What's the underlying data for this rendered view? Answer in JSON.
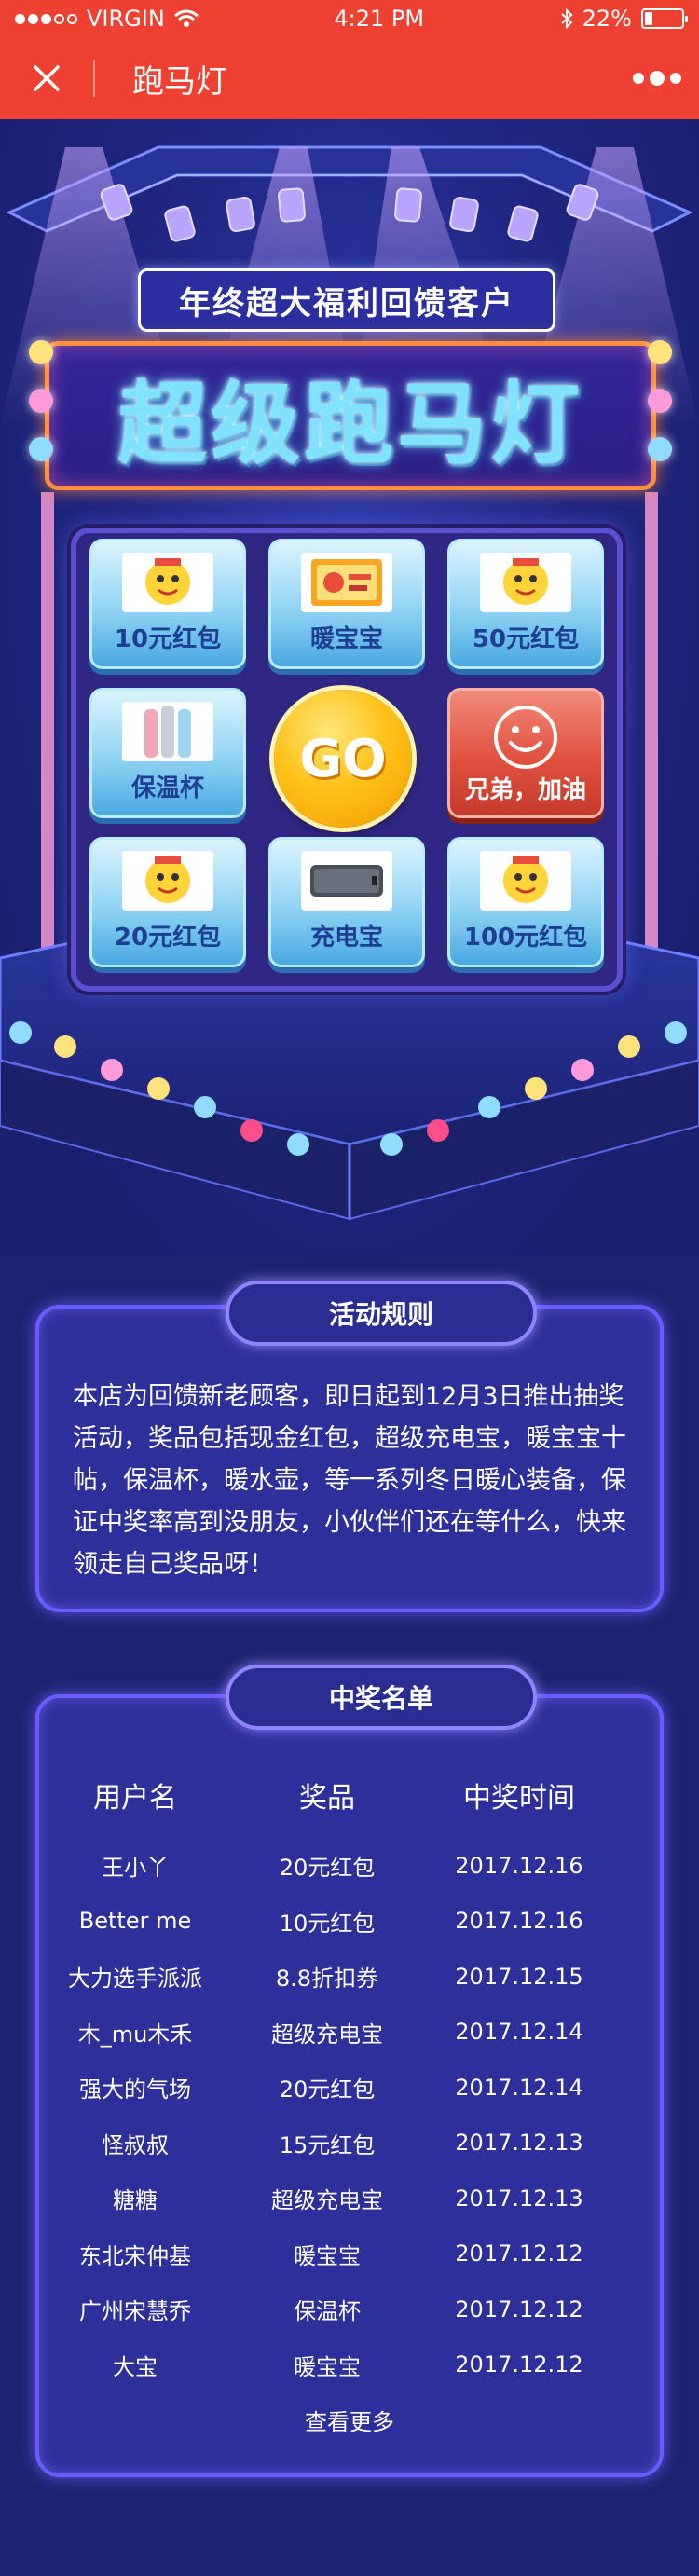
{
  "status_bar": {
    "carrier": "VIRGIN",
    "time": "4:21 PM",
    "battery": "22%",
    "battery_level": 0.22
  },
  "nav": {
    "title": "跑马灯",
    "close_icon": "close-icon",
    "more_icon": "more-dots-icon"
  },
  "hero": {
    "banner": "年终超大福利回馈客户",
    "title": "超级跑马灯"
  },
  "board": {
    "go_label": "GO",
    "prizes": [
      {
        "label": "10元红包",
        "icon": "red-envelope-mascot-icon"
      },
      {
        "label": "暖宝宝",
        "icon": "heat-pack-icon"
      },
      {
        "label": "50元红包",
        "icon": "red-envelope-mascot-icon"
      },
      {
        "label": "保温杯",
        "icon": "thermos-icon"
      },
      {
        "label": "兄弟，加油",
        "icon": "smiley-icon"
      },
      {
        "label": "20元红包",
        "icon": "red-envelope-mascot-icon"
      },
      {
        "label": "充电宝",
        "icon": "power-bank-icon"
      },
      {
        "label": "100元红包",
        "icon": "red-envelope-mascot-icon"
      }
    ]
  },
  "rules": {
    "title": "活动规则",
    "text": "本店为回馈新老顾客，即日起到12月3日推出抽奖活动，奖品包括现金红包，超级充电宝，暖宝宝十帖，保温杯，暖水壶，等一系列冬日暖心装备，保证中奖率高到没朋友，小伙伴们还在等什么，快来领走自己奖品呀！"
  },
  "winners": {
    "title": "中奖名单",
    "columns": [
      "用户名",
      "奖品",
      "中奖时间"
    ],
    "rows": [
      [
        "王小丫",
        "20元红包",
        "2017.12.16"
      ],
      [
        "Better me",
        "10元红包",
        "2017.12.16"
      ],
      [
        "大力选手派派",
        "8.8折扣券",
        "2017.12.15"
      ],
      [
        "木_mu木禾",
        "超级充电宝",
        "2017.12.14"
      ],
      [
        "强大的气场",
        "20元红包",
        "2017.12.14"
      ],
      [
        "怪叔叔",
        "15元红包",
        "2017.12.13"
      ],
      [
        "糖糖",
        "超级充电宝",
        "2017.12.13"
      ],
      [
        "东北宋仲基",
        "暖宝宝",
        "2017.12.12"
      ],
      [
        "广州宋慧乔",
        "保温杯",
        "2017.12.12"
      ],
      [
        "大宝",
        "暖宝宝",
        "2017.12.12"
      ]
    ],
    "more_label": "查看更多"
  },
  "colors": {
    "nav_red": "#ef4131",
    "page_bg": "#1d2370",
    "panel_border": "#6a5cff",
    "go_yellow": "#ffc21a"
  }
}
